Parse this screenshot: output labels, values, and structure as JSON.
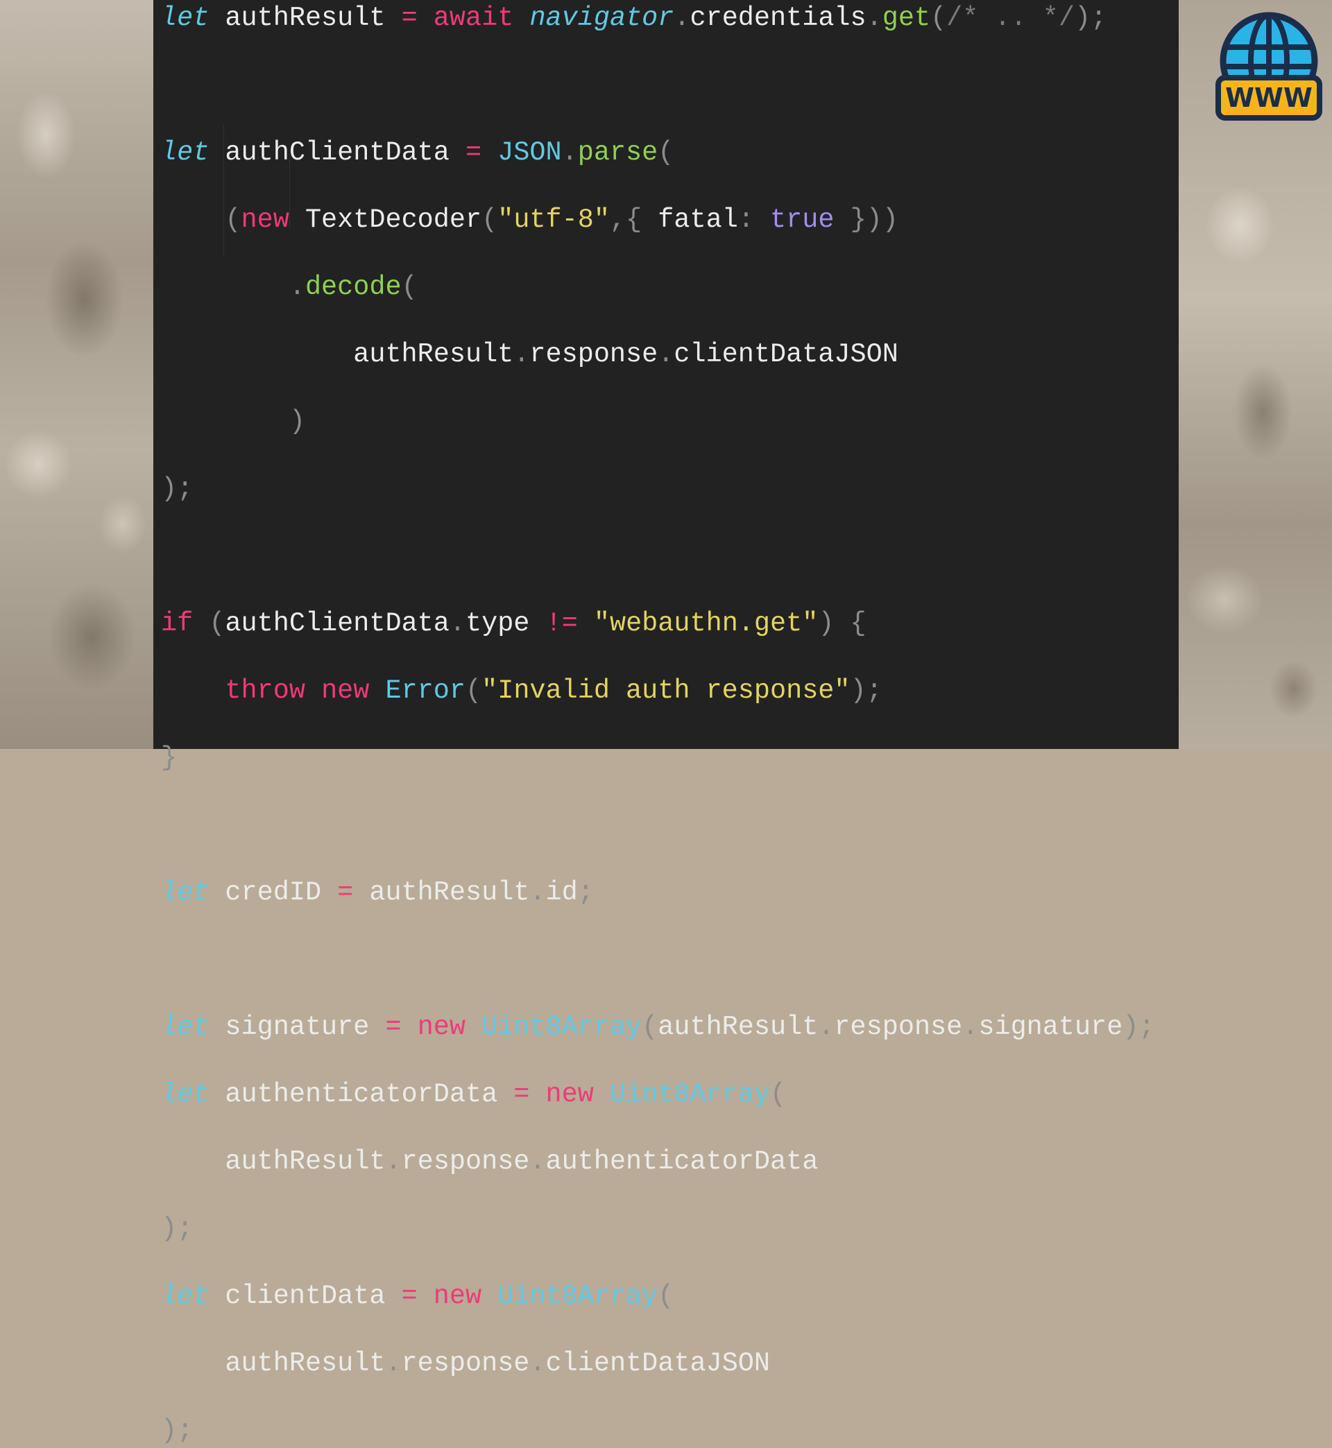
{
  "icons": {
    "corner": "www-globe-icon",
    "corner_label": "WWW"
  },
  "colors": {
    "background": "#222222",
    "keyword": "#f0397a",
    "let": "#5fc9e6",
    "function": "#8ed14e",
    "string": "#e4d45c",
    "boolean": "#a48bf2"
  },
  "code": {
    "l1": {
      "let": "let",
      "name": "authResult",
      "eq": "=",
      "await": "await",
      "obj": "navigator",
      "prop": "credentials",
      "fn": "get",
      "open": "(",
      "comment": "/* .. */",
      "close": ");"
    },
    "l3": {
      "let": "let",
      "name": "authClientData",
      "eq": "=",
      "cls": "JSON",
      "fn": "parse",
      "open": "("
    },
    "l4": {
      "open": "(",
      "new": "new",
      "cls": "TextDecoder",
      "p1": "(",
      "str": "\"utf-8\"",
      "p2": ",{",
      "key": "fatal",
      "colon": ":",
      "bool": "true",
      "close": "}))"
    },
    "l5": {
      "fn": "decode",
      "open": "("
    },
    "l6": {
      "a": "authResult",
      "b": "response",
      "c": "clientDataJSON"
    },
    "l7": {
      "close": ")"
    },
    "l8": {
      "close": ");"
    },
    "l10": {
      "if": "if",
      "open": "(",
      "obj": "authClientData",
      "prop": "type",
      "op": "!=",
      "str": "\"webauthn.get\"",
      "close": ")",
      "brace": "{"
    },
    "l11": {
      "throw": "throw",
      "new": "new",
      "cls": "Error",
      "open": "(",
      "str": "\"Invalid auth response\"",
      "close": ");"
    },
    "l12": {
      "brace": "}"
    },
    "l14": {
      "let": "let",
      "name": "credID",
      "eq": "=",
      "obj": "authResult",
      "prop": "id",
      "end": ";"
    },
    "l16": {
      "let": "let",
      "name": "signature",
      "eq": "=",
      "new": "new",
      "cls": "Uint8Array",
      "open": "(",
      "a": "authResult",
      "b": "response",
      "c": "signature",
      "close": ");"
    },
    "l17": {
      "let": "let",
      "name": "authenticatorData",
      "eq": "=",
      "new": "new",
      "cls": "Uint8Array",
      "open": "("
    },
    "l18": {
      "a": "authResult",
      "b": "response",
      "c": "authenticatorData"
    },
    "l19": {
      "close": ");"
    },
    "l20": {
      "let": "let",
      "name": "clientData",
      "eq": "=",
      "new": "new",
      "cls": "Uint8Array",
      "open": "("
    },
    "l21": {
      "a": "authResult",
      "b": "response",
      "c": "clientDataJSON"
    },
    "l22": {
      "close": ");"
    }
  }
}
